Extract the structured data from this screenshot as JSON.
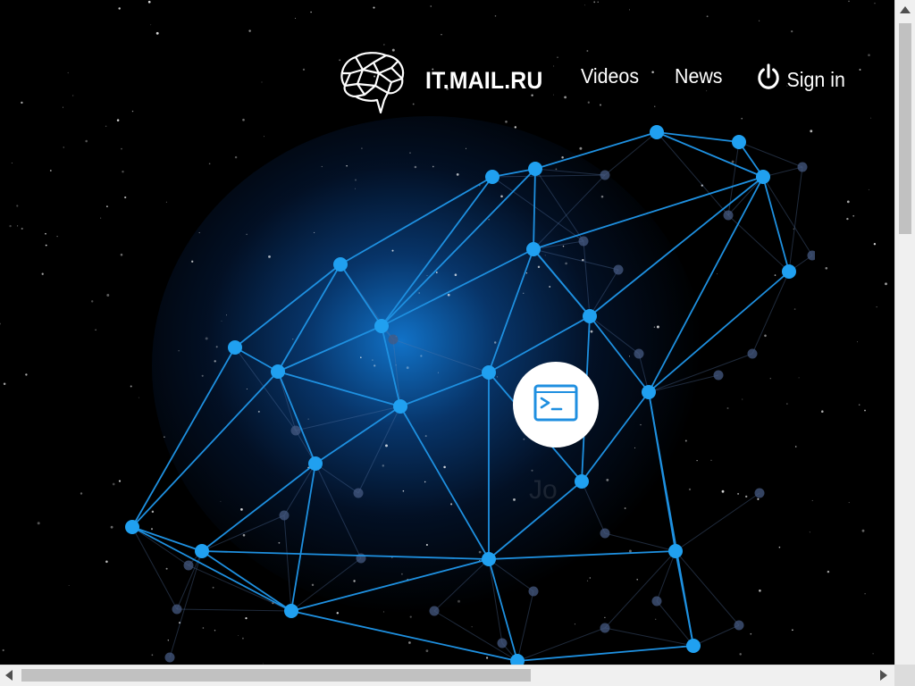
{
  "header": {
    "brand_name": "IT.MAIL.RU",
    "logo_icon": "brain-icon",
    "nav": [
      {
        "label": "Videos"
      },
      {
        "label": "News"
      }
    ],
    "signin": {
      "label": "Sign in",
      "icon": "power-icon"
    }
  },
  "hero": {
    "cta_icon": "terminal-icon",
    "ghost_text": "Jo"
  },
  "colors": {
    "background": "#000000",
    "network_line": "#1e90e0",
    "network_node": "#20a0f0",
    "text": "#ffffff"
  }
}
